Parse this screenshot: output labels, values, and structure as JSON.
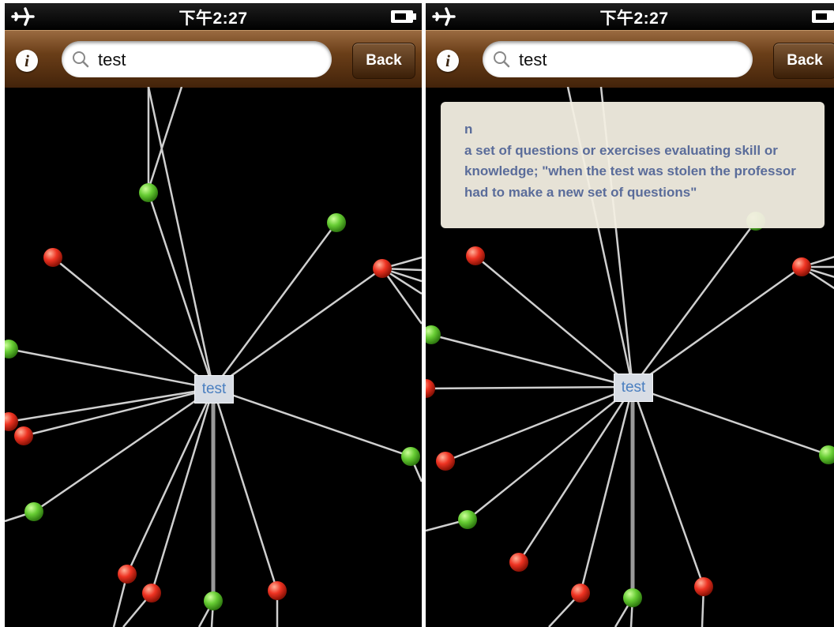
{
  "status": {
    "time": "下午2:27"
  },
  "nav": {
    "info_label": "i",
    "search_value": "test",
    "back_label": "Back"
  },
  "graph": {
    "center_word": "test"
  },
  "popup": {
    "pos": "n",
    "definition": " a set of questions or exercises evaluating skill or knowledge; \"when the test was stolen the professor had to make a new set of questions\""
  },
  "colors": {
    "node_green": "#66cc33",
    "node_red": "#ee3322",
    "nav_brown": "#6a3e18",
    "center_text": "#4a7fc0"
  },
  "icons": [
    "airplane-icon",
    "battery-icon",
    "info-icon",
    "search-icon"
  ]
}
